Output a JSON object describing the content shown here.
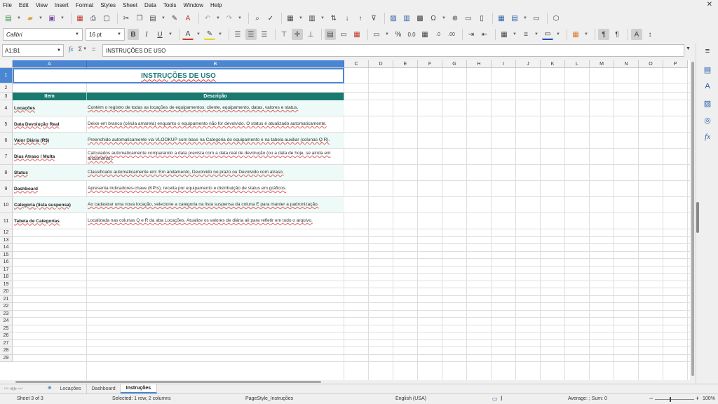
{
  "menu": [
    "File",
    "Edit",
    "View",
    "Insert",
    "Format",
    "Styles",
    "Sheet",
    "Data",
    "Tools",
    "Window",
    "Help"
  ],
  "toolbar": {
    "font_name": "Calibri",
    "font_size": "16 pt"
  },
  "formula_bar": {
    "name_box": "A1:B1",
    "sum_symbol": "Σ",
    "equals_symbol": "=",
    "fx_symbol": "fx",
    "content": "INSTRUÇÕES DE USO"
  },
  "columns": [
    "A",
    "B",
    "C",
    "D",
    "E",
    "F",
    "G",
    "H",
    "I",
    "J",
    "K",
    "L",
    "M",
    "N",
    "O",
    "P"
  ],
  "rows": [
    "1",
    "2",
    "3",
    "4",
    "5",
    "6",
    "7",
    "8",
    "9",
    "10",
    "11",
    "12",
    "13",
    "14",
    "15",
    "16",
    "17",
    "18",
    "19",
    "20",
    "21",
    "22",
    "23",
    "24",
    "25",
    "26",
    "27",
    "28",
    "29"
  ],
  "sheet": {
    "title": "INSTRUÇÕES DE USO",
    "headers": [
      "Item",
      "Descrição"
    ],
    "items": [
      {
        "item": "Locações",
        "desc": "Contém o registro de todas as locações de equipamentos: cliente, equipamento, datas, valores e status."
      },
      {
        "item": "Data Devolução Real",
        "desc": "Deixe em branco (célula amarela) enquanto o equipamento não for devolvido. O status é atualizado automaticamente."
      },
      {
        "item": "Valor Diária (R$)",
        "desc": "Preenchido automaticamente via VLOOKUP com base na Categoria do equipamento e na tabela auxiliar (colunas Q:R)."
      },
      {
        "item": "Dias Atraso / Multa",
        "desc": "Calculados automaticamente comparando a data prevista com a data real de devolução (ou a data de hoje, se ainda em andamento)."
      },
      {
        "item": "Status",
        "desc": "Classificado automaticamente em: Em andamento, Devolvido no prazo ou Devolvido com atraso."
      },
      {
        "item": "Dashboard",
        "desc": "Apresenta indicadores-chave (KPIs), receita por equipamento e distribuição de status em gráficos."
      },
      {
        "item": "Categoria (lista suspensa)",
        "desc": "Ao cadastrar uma nova locação, selecione a categoria na lista suspensa da coluna E para manter a padronização."
      },
      {
        "item": "Tabela de Categorias",
        "desc": "Localizada nas colunas Q e R da aba Locações. Atualize os valores de diária ali para refletir em todo o arquivo."
      }
    ]
  },
  "tabs": [
    "Locações",
    "Dashboard",
    "Instruções"
  ],
  "status_bar": {
    "sheet": "Sheet 3 of 3",
    "selection": "Selected: 1 row, 2 columns",
    "page_style": "PageStyle_Instruções",
    "language": "English (USA)",
    "summary": "Average: ; Sum: 0",
    "zoom": "100%"
  },
  "colors": {
    "accent": "#4a86d4",
    "header_fill": "#1a7a70",
    "title_text": "#1c7d77",
    "band_fill": "#eefaf7"
  }
}
